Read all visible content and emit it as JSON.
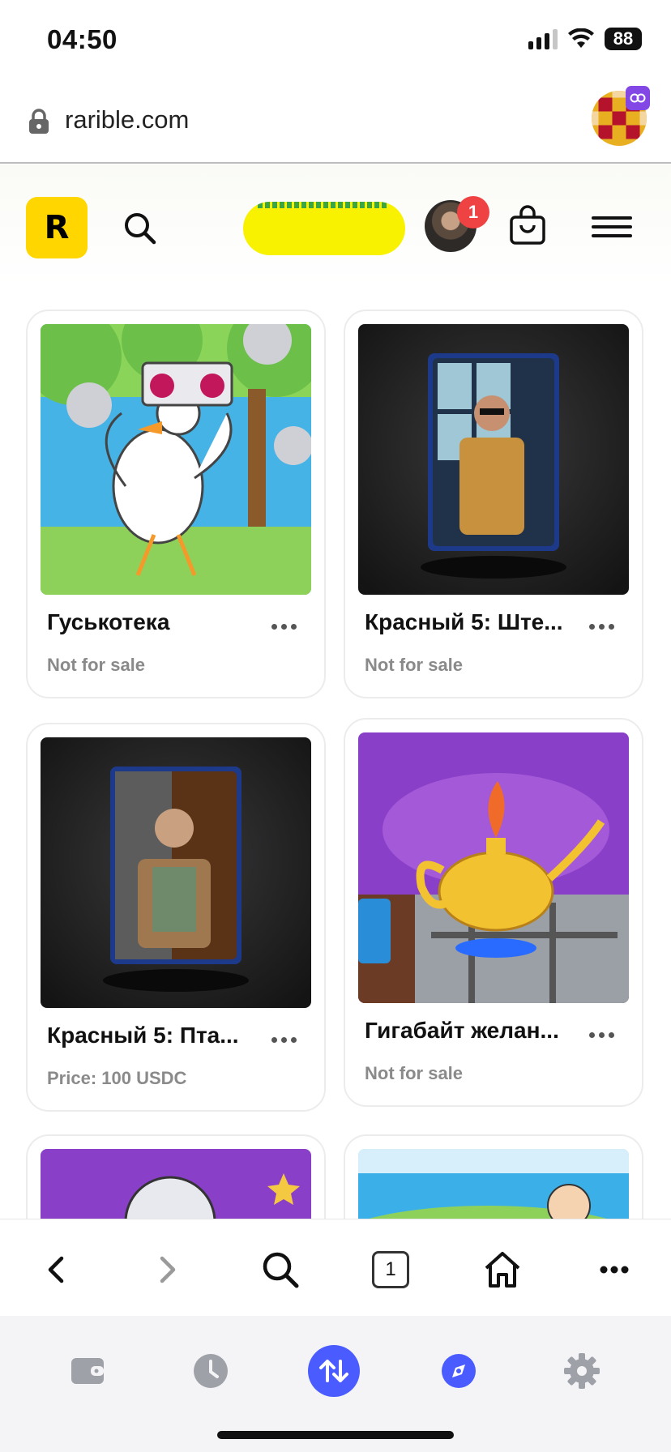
{
  "status_bar": {
    "time": "04:50",
    "battery": "88"
  },
  "browser": {
    "url": "rarible.com",
    "tab_count": "1"
  },
  "header": {
    "logo_letter": "R",
    "notification_count": "1"
  },
  "nfts": [
    {
      "title": "Гуськотека",
      "status": "Not for sale"
    },
    {
      "title": "Красный 5: Ште...",
      "status": "Not for sale"
    },
    {
      "title": "Красный 5: Пта...",
      "status": "Price: 100 USDC"
    },
    {
      "title": "Гигабайт желан...",
      "status": "Not for sale"
    }
  ],
  "colors": {
    "brand_yellow": "#ffd600",
    "badge_red": "#ef4343",
    "accent_blue": "#4a5cff"
  },
  "icons": [
    "lock-icon",
    "search-icon",
    "bag-icon",
    "menu-icon",
    "more-icon",
    "back-icon",
    "forward-icon",
    "home-icon",
    "wallet-icon",
    "history-icon",
    "swap-icon",
    "discover-icon",
    "settings-icon"
  ]
}
